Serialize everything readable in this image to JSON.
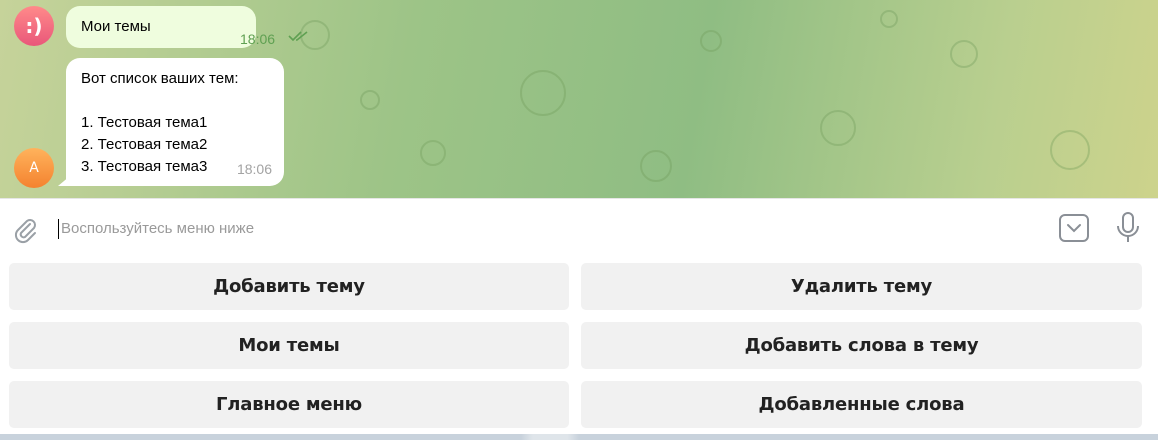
{
  "chat": {
    "bot_avatar": ":)",
    "user_avatar": "A",
    "outgoing": {
      "text": "Мои темы",
      "time": "18:06",
      "status_icon": "double-check-icon"
    },
    "incoming": {
      "lines": [
        "Вот список ваших тем:",
        "",
        "1. Тестовая тема1",
        "2. Тестовая тема2",
        "3. Тестовая тема3"
      ],
      "time": "18:06"
    }
  },
  "composer": {
    "placeholder": "Воспользуйтесь меню ниже",
    "value": "",
    "attach_icon": "paperclip-icon",
    "keyboard_icon": "keyboard-toggle-icon",
    "mic_icon": "microphone-icon"
  },
  "keyboard": {
    "buttons": [
      {
        "label": "Добавить тему"
      },
      {
        "label": "Удалить тему"
      },
      {
        "label": "Мои темы"
      },
      {
        "label": "Добавить слова в тему"
      },
      {
        "label": "Главное меню"
      },
      {
        "label": "Добавленные слова"
      }
    ]
  },
  "colors": {
    "outgoing_bubble": "#effdde",
    "incoming_bubble": "#ffffff",
    "button_bg": "#f1f1f1",
    "time_out": "#5fa052",
    "time_in": "#a3a3a3"
  }
}
